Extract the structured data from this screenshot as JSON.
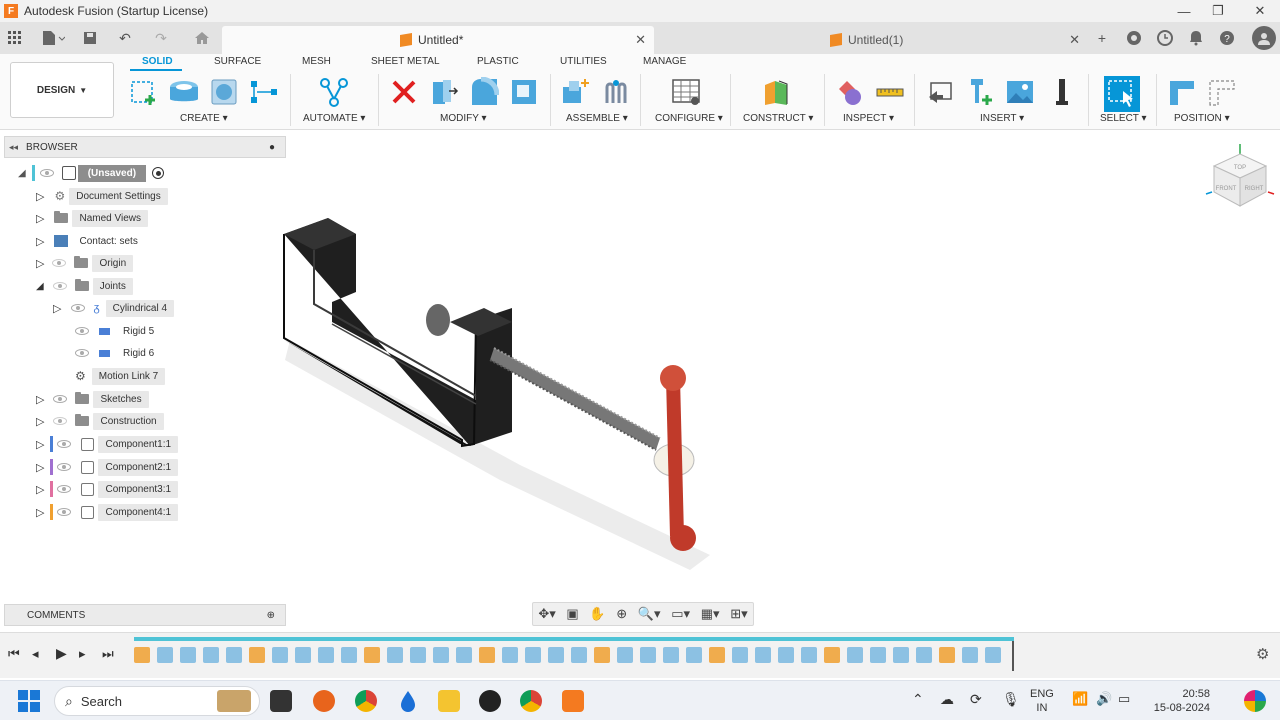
{
  "window": {
    "title": "Autodesk Fusion (Startup License)"
  },
  "tabs": [
    {
      "label": "Untitled*",
      "active": true
    },
    {
      "label": "Untitled(1)",
      "active": false
    }
  ],
  "workspace": {
    "label": "DESIGN"
  },
  "ribbon_tabs": [
    "SOLID",
    "SURFACE",
    "MESH",
    "SHEET METAL",
    "PLASTIC",
    "UTILITIES",
    "MANAGE"
  ],
  "ribbon_groups": {
    "create": "CREATE",
    "automate": "AUTOMATE",
    "modify": "MODIFY",
    "assemble": "ASSEMBLE",
    "configure": "CONFIGURE",
    "construct": "CONSTRUCT",
    "inspect": "INSPECT",
    "insert": "INSERT",
    "select": "SELECT",
    "position": "POSITION"
  },
  "browser": {
    "title": "BROWSER",
    "root": "(Unsaved)",
    "items": [
      {
        "label": "Document Settings"
      },
      {
        "label": "Named Views"
      },
      {
        "label": "Contact: sets"
      },
      {
        "label": "Origin"
      },
      {
        "label": "Joints"
      },
      {
        "label": "Cylindrical 4"
      },
      {
        "label": "Rigid 5"
      },
      {
        "label": "Rigid 6"
      },
      {
        "label": "Motion Link 7"
      },
      {
        "label": "Sketches"
      },
      {
        "label": "Construction"
      },
      {
        "label": "Component1:1",
        "color": "#4a7fd6"
      },
      {
        "label": "Component2:1",
        "color": "#a070d0"
      },
      {
        "label": "Component3:1",
        "color": "#e070a0"
      },
      {
        "label": "Component4:1",
        "color": "#f0a030"
      }
    ]
  },
  "comments": {
    "label": "COMMENTS"
  },
  "viewcube": {
    "top": "TOP",
    "front": "FRONT",
    "right": "RIGHT"
  },
  "taskbar": {
    "search_placeholder": "Search",
    "lang_line1": "ENG",
    "lang_line2": "IN",
    "time": "20:58",
    "date": "15-08-2024"
  },
  "colors": {
    "accent": "#0696d7",
    "fusion_orange": "#f47a20",
    "timeline_teal": "#4fc3d6"
  }
}
